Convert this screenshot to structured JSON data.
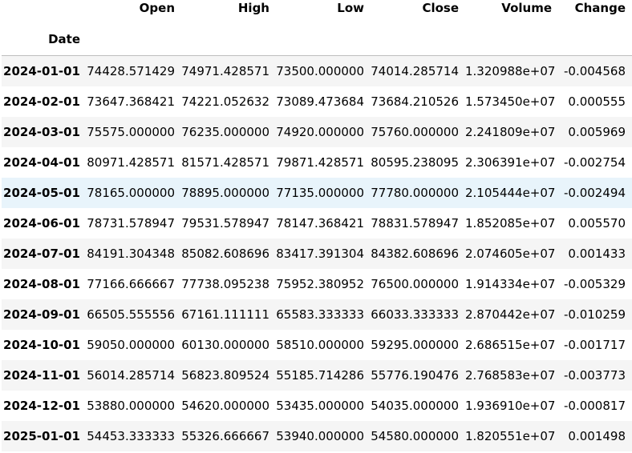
{
  "table": {
    "columns": [
      "Open",
      "High",
      "Low",
      "Close",
      "Volume",
      "Change"
    ],
    "index_name": "Date",
    "rows": [
      {
        "date": "2024-01-01",
        "values": [
          "74428.571429",
          "74971.428571",
          "73500.000000",
          "74014.285714",
          "1.320988e+07",
          "-0.004568"
        ]
      },
      {
        "date": "2024-02-01",
        "values": [
          "73647.368421",
          "74221.052632",
          "73089.473684",
          "73684.210526",
          "1.573450e+07",
          "0.000555"
        ]
      },
      {
        "date": "2024-03-01",
        "values": [
          "75575.000000",
          "76235.000000",
          "74920.000000",
          "75760.000000",
          "2.241809e+07",
          "0.005969"
        ]
      },
      {
        "date": "2024-04-01",
        "values": [
          "80971.428571",
          "81571.428571",
          "79871.428571",
          "80595.238095",
          "2.306391e+07",
          "-0.002754"
        ]
      },
      {
        "date": "2024-05-01",
        "values": [
          "78165.000000",
          "78895.000000",
          "77135.000000",
          "77780.000000",
          "2.105444e+07",
          "-0.002494"
        ]
      },
      {
        "date": "2024-06-01",
        "values": [
          "78731.578947",
          "79531.578947",
          "78147.368421",
          "78831.578947",
          "1.852085e+07",
          "0.005570"
        ]
      },
      {
        "date": "2024-07-01",
        "values": [
          "84191.304348",
          "85082.608696",
          "83417.391304",
          "84382.608696",
          "2.074605e+07",
          "0.001433"
        ]
      },
      {
        "date": "2024-08-01",
        "values": [
          "77166.666667",
          "77738.095238",
          "75952.380952",
          "76500.000000",
          "1.914334e+07",
          "-0.005329"
        ]
      },
      {
        "date": "2024-09-01",
        "values": [
          "66505.555556",
          "67161.111111",
          "65583.333333",
          "66033.333333",
          "2.870442e+07",
          "-0.010259"
        ]
      },
      {
        "date": "2024-10-01",
        "values": [
          "59050.000000",
          "60130.000000",
          "58510.000000",
          "59295.000000",
          "2.686515e+07",
          "-0.001717"
        ]
      },
      {
        "date": "2024-11-01",
        "values": [
          "56014.285714",
          "56823.809524",
          "55185.714286",
          "55776.190476",
          "2.768583e+07",
          "-0.003773"
        ]
      },
      {
        "date": "2024-12-01",
        "values": [
          "53880.000000",
          "54620.000000",
          "53435.000000",
          "54035.000000",
          "1.936910e+07",
          "-0.000817"
        ]
      },
      {
        "date": "2025-01-01",
        "values": [
          "54453.333333",
          "55326.666667",
          "53940.000000",
          "54580.000000",
          "1.820551e+07",
          "0.001498"
        ]
      }
    ]
  }
}
